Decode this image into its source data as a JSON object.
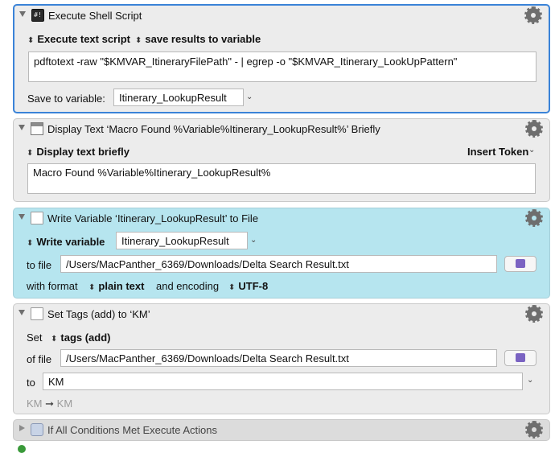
{
  "action1": {
    "title": "Execute Shell Script",
    "source_option": "Execute text script",
    "output_option": "save results to variable",
    "script": "pdftotext -raw \"$KMVAR_ItineraryFilePath\" - | egrep -o \"$KMVAR_Itinerary_LookUpPattern\"",
    "save_label": "Save to variable:",
    "variable": "Itinerary_LookupResult"
  },
  "action2": {
    "title": "Display Text ‘Macro Found %Variable%Itinerary_LookupResult%’ Briefly",
    "mode": "Display text briefly",
    "insert_token": "Insert Token",
    "text": "Macro Found %Variable%Itinerary_LookupResult%"
  },
  "action3": {
    "title": "Write Variable ‘Itinerary_LookupResult’ to File",
    "mode": "Write variable",
    "variable": "Itinerary_LookupResult",
    "to_file_label": "to file",
    "file_path": "/Users/MacPanther_6369/Downloads/Delta Search Result.txt",
    "format_label": "with format",
    "format": "plain text",
    "encoding_label": "and encoding",
    "encoding": "UTF-8"
  },
  "action4": {
    "title": "Set Tags (add) to ‘KM’",
    "set_label": "Set",
    "mode": "tags (add)",
    "of_file_label": "of file",
    "file_path": "/Users/MacPanther_6369/Downloads/Delta Search Result.txt",
    "to_label": "to",
    "tags_value": "KM",
    "preview_from": "KM",
    "preview_arrow": "➞",
    "preview_to": "KM"
  },
  "action5": {
    "title": "If All Conditions Met Execute Actions"
  }
}
